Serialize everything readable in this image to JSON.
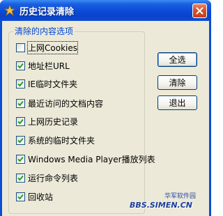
{
  "window": {
    "title": "历史记录清除"
  },
  "group": {
    "title": "清除的内容选项"
  },
  "options": [
    {
      "label": "上网Cookies",
      "checked": false
    },
    {
      "label": "地址栏URL",
      "checked": true
    },
    {
      "label": "IE临时文件夹",
      "checked": true
    },
    {
      "label": "最近访问的文档内容",
      "checked": true
    },
    {
      "label": "上网历史记录",
      "checked": true
    },
    {
      "label": "系统的临时文件夹",
      "checked": true
    },
    {
      "label": "Windows Media Player播放列表",
      "checked": true
    },
    {
      "label": "运行命令列表",
      "checked": true
    },
    {
      "label": "回收站",
      "checked": true
    }
  ],
  "buttons": {
    "select_all": "全选",
    "clear": "清除",
    "exit": "退出"
  },
  "watermark": {
    "top": "华军软件园",
    "text": "BBS.SIMEN.CN"
  },
  "colors": {
    "titlebar": "#0b49d6",
    "dialog_bg": "#ece9d8",
    "group_title": "#0046d5",
    "close_button": "#d6502a"
  }
}
